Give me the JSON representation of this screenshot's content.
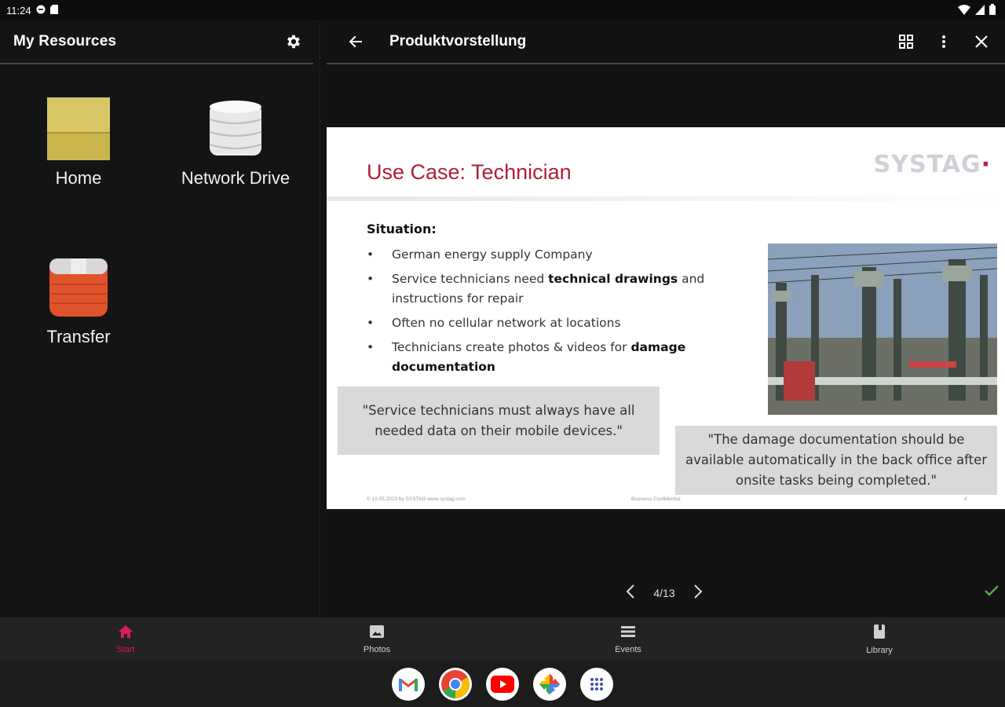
{
  "status_bar": {
    "time": "11:24"
  },
  "left_pane": {
    "title": "My Resources",
    "items": [
      {
        "label": "Home"
      },
      {
        "label": "Network Drive"
      },
      {
        "label": "Transfer"
      }
    ]
  },
  "document": {
    "title": "Produktvorstellung",
    "page_indicator": "4/13"
  },
  "slide": {
    "title": "Use Case: Technician",
    "logo": "SYSTAG",
    "situation_label": "Situation:",
    "bullets": [
      {
        "before": "German energy supply Company",
        "bold": "",
        "after": ""
      },
      {
        "before": "Service technicians need ",
        "bold": "technical drawings",
        "after": " and instructions for repair"
      },
      {
        "before": "Often no cellular network at locations",
        "bold": "",
        "after": ""
      },
      {
        "before": "Technicians create photos & videos for ",
        "bold": "damage documentation",
        "after": ""
      }
    ],
    "quote_1": "\"Service technicians must always have all needed data on their mobile devices.\"",
    "quote_2": "\"The damage documentation should be available automatically in the back office after onsite tasks being completed.\"",
    "footer_left": "© 15.05.2023 by SYSTAG www.systag.com",
    "footer_center": "Business Confidential",
    "footer_right": "4"
  },
  "bottom_nav": [
    {
      "label": "Start",
      "active": true
    },
    {
      "label": "Photos",
      "active": false
    },
    {
      "label": "Events",
      "active": false
    },
    {
      "label": "Library",
      "active": false
    }
  ],
  "dock_apps": [
    "gmail-icon",
    "chrome-icon",
    "youtube-icon",
    "photos-icon",
    "app-drawer-icon"
  ],
  "colors": {
    "accent": "#d81b60",
    "slide_title": "#b01e35",
    "check": "#4caf50"
  }
}
